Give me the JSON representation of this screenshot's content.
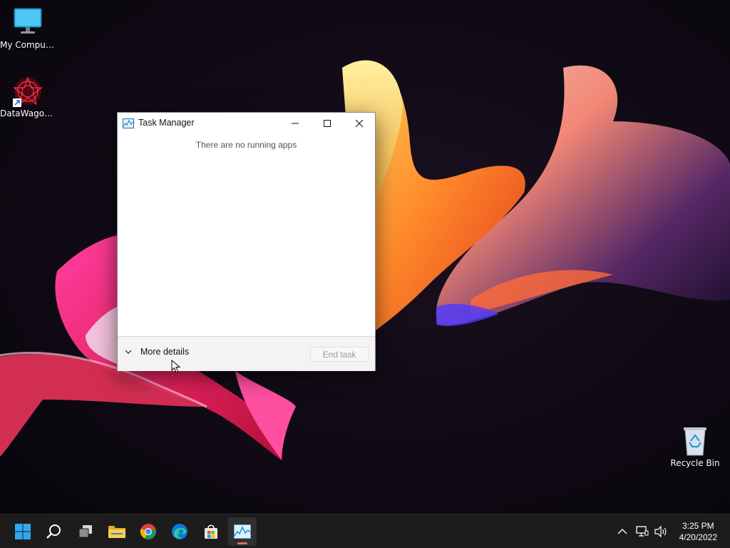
{
  "desktop": {
    "icons": [
      {
        "label": "My Computer"
      },
      {
        "label": "DataWagon..."
      },
      {
        "label": "Recycle Bin"
      }
    ]
  },
  "window": {
    "title": "Task Manager",
    "empty_message": "There are no running apps",
    "more_details_label": "More details",
    "end_task_label": "End task"
  },
  "taskbar": {
    "apps": [
      "start-icon",
      "search-icon",
      "task-view-icon",
      "file-explorer-icon",
      "chrome-icon",
      "edge-icon",
      "store-icon",
      "task-manager-icon"
    ],
    "clock": {
      "time": "3:25 PM",
      "date": "4/20/2022"
    }
  },
  "colors": {
    "taskbar": "#1c1c1c",
    "accent": "#0078d4",
    "active_indicator": "#e36a5c"
  }
}
